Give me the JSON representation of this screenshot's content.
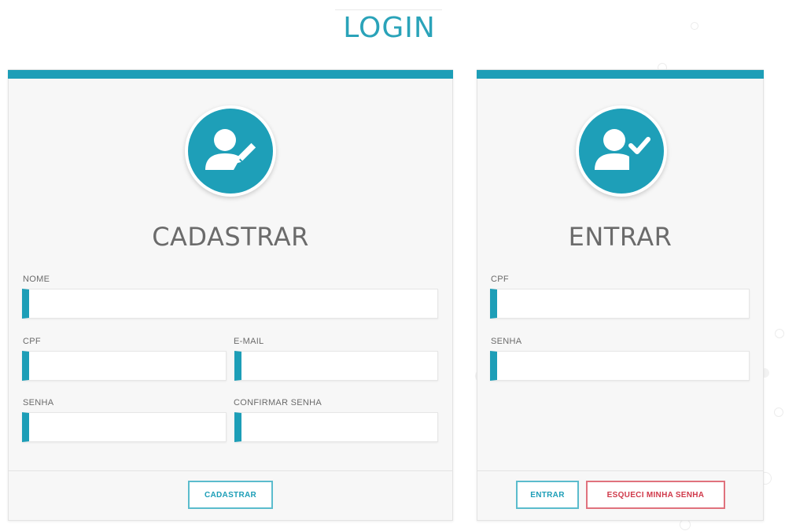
{
  "page": {
    "title": "LOGIN"
  },
  "register": {
    "heading": "CADASTRAR",
    "fields": {
      "name": {
        "label": "NOME",
        "value": ""
      },
      "cpf": {
        "label": "CPF",
        "value": ""
      },
      "email": {
        "label": "E-MAIL",
        "value": ""
      },
      "password": {
        "label": "SENHA",
        "value": ""
      },
      "confirm_password": {
        "label": "CONFIRMAR SENHA",
        "value": ""
      }
    },
    "submit_label": "CADASTRAR"
  },
  "login": {
    "heading": "ENTRAR",
    "fields": {
      "cpf": {
        "label": "CPF",
        "value": ""
      },
      "password": {
        "label": "SENHA",
        "value": ""
      }
    },
    "submit_label": "ENTRAR",
    "forgot_label": "ESQUECI MINHA SENHA"
  },
  "icons": {
    "register_avatar": "user-edit-icon",
    "login_avatar": "user-check-icon"
  },
  "colors": {
    "accent": "#1d9eb7",
    "danger": "#d0394a",
    "card_bg": "#f7f7f7",
    "text_muted": "#6b6b6b"
  }
}
